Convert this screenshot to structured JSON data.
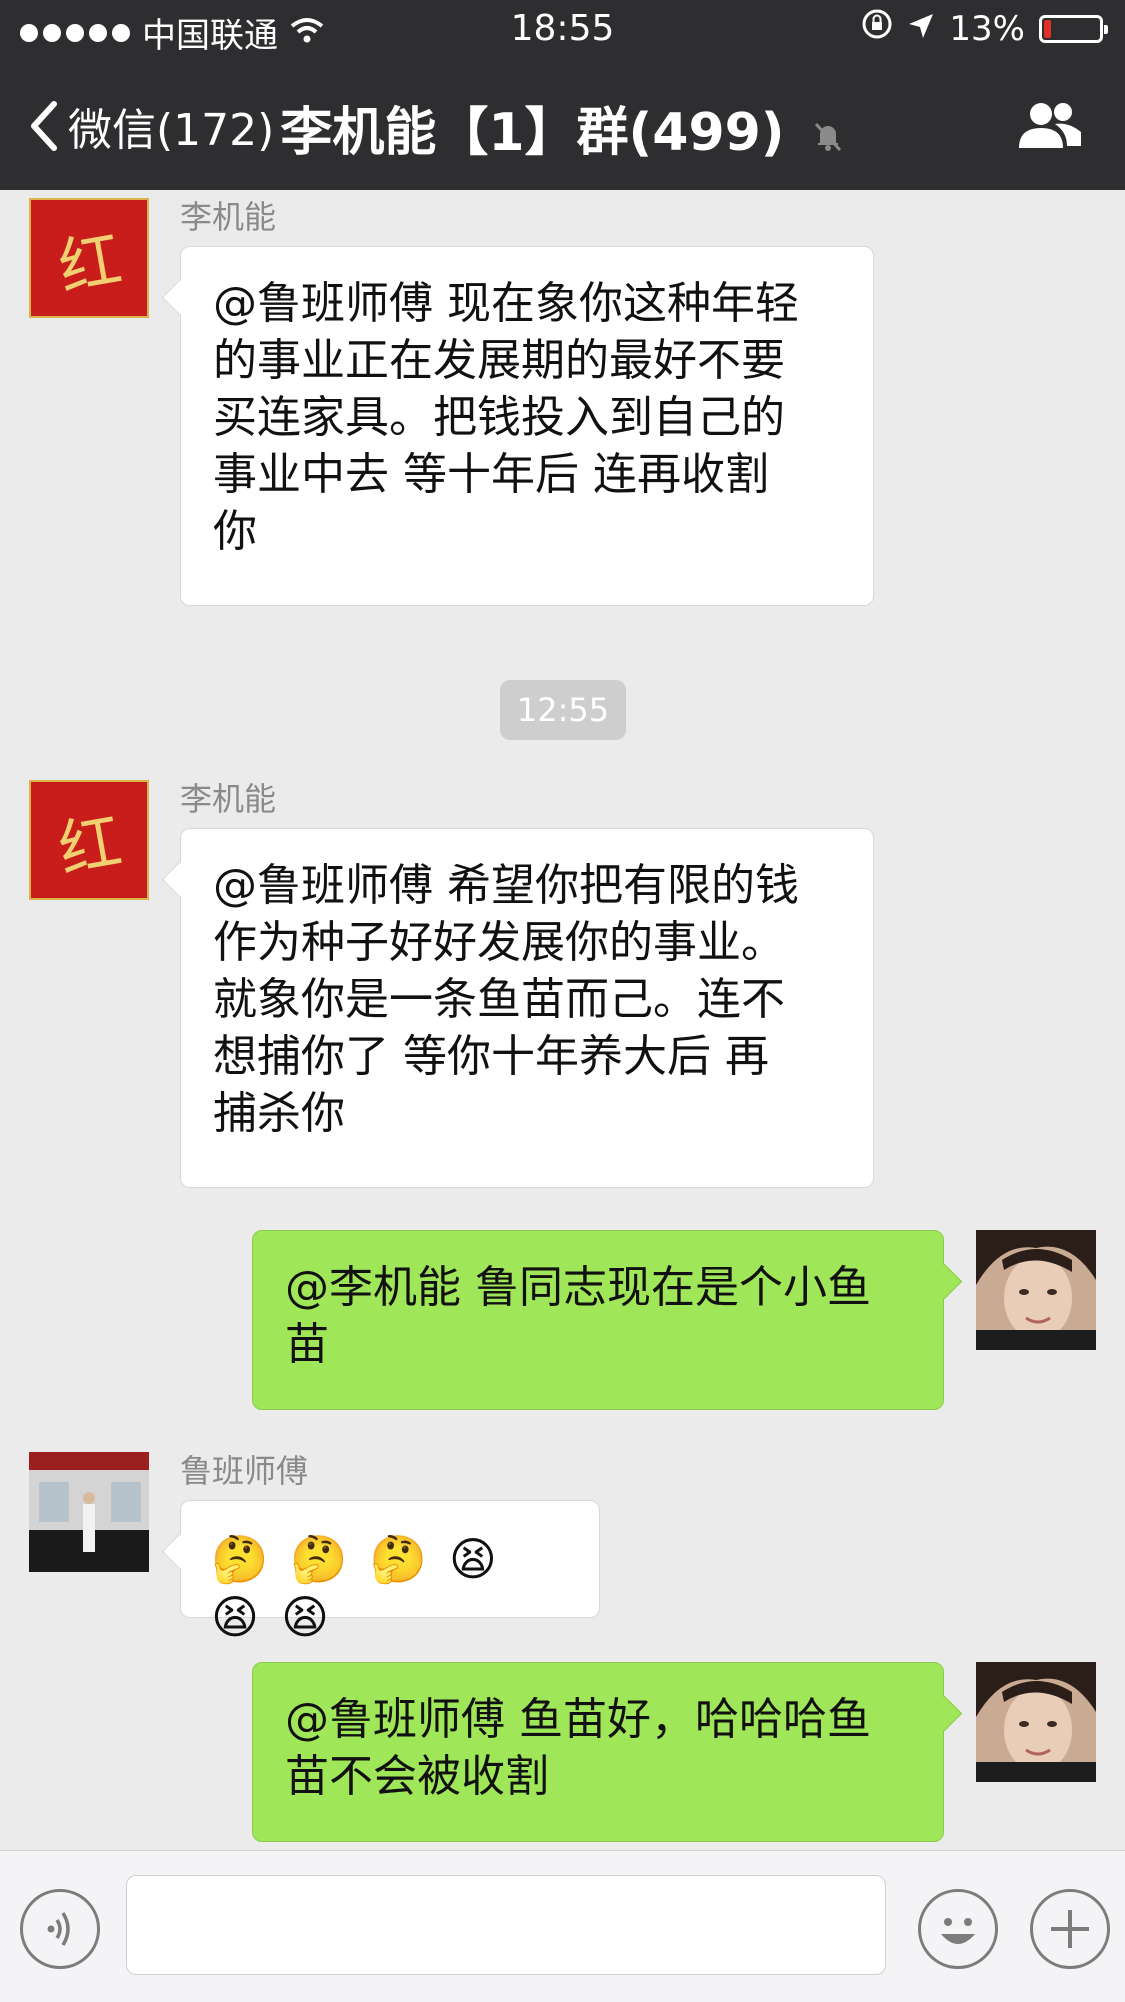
{
  "status_bar": {
    "carrier": "中国联通",
    "time": "18:55",
    "battery": "13%",
    "battery_level": 0.13
  },
  "nav": {
    "back_label": "微信(172)",
    "title": "李机能【1】群(499)"
  },
  "messages": [
    {
      "sender": "李机能",
      "text_lines": [
        "@鲁班师傅 现在象你这种年轻",
        "的事业正在发展期的最好不要",
        "买连家具。把钱投入到自己的",
        "事业中去  等十年后  连再收割",
        "你"
      ]
    },
    {
      "timestamp": "12:55"
    },
    {
      "sender": "李机能",
      "text_lines": [
        "@鲁班师傅 希望你把有限的钱",
        "作为种子好好发展你的事业。",
        "就象你是一条鱼苗而己。连不",
        "想捕你了  等你十年养大后  再",
        "捕杀你"
      ]
    },
    {
      "self": true,
      "text_lines": [
        "@李机能 鲁同志现在是个小鱼",
        "苗"
      ]
    },
    {
      "sender": "鲁班师傅",
      "emojis": [
        "🤔",
        "🤔",
        "🤔",
        "😫",
        "😫",
        "😫"
      ]
    },
    {
      "self": true,
      "text_lines": [
        "@鲁班师傅 鱼苗好，哈哈哈鱼",
        "苗不会被收割"
      ]
    }
  ],
  "avatar_glyph": "红"
}
